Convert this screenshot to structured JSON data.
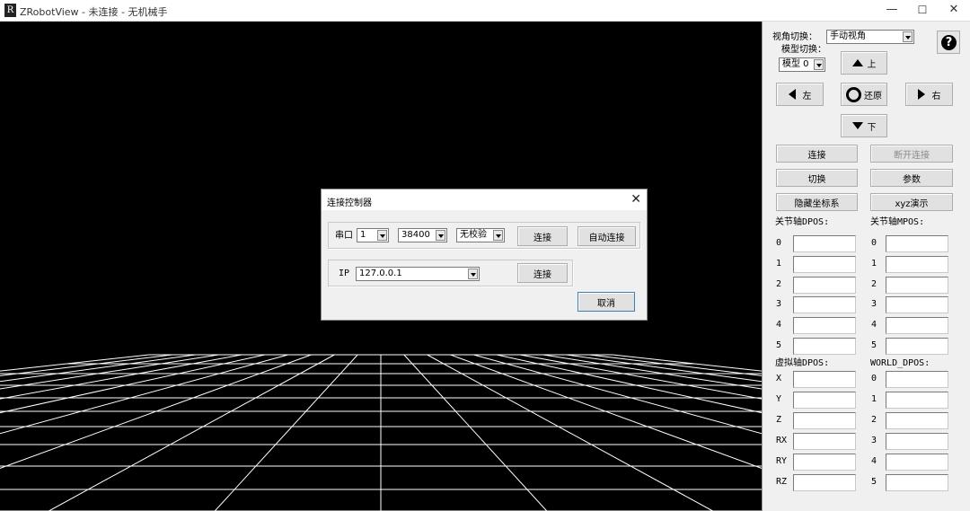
{
  "window": {
    "title": "ZRobotView - 未连接 - 无机械手",
    "icon_letter": "R",
    "minimize": "—",
    "maximize": "☐",
    "close": "✕"
  },
  "panel": {
    "view_switch_label": "视角切换：",
    "view_switch_value": "手动视角",
    "model_switch_label": "模型切换：",
    "model_value": "模型 0",
    "help": "?",
    "nav": {
      "up": "上",
      "left": "左",
      "reset": "还原",
      "right": "右",
      "down": "下"
    },
    "buttons": {
      "connect": "连接",
      "disconnect": "断开连接",
      "switch": "切换",
      "params": "参数",
      "hide_coords": "隐藏坐标系",
      "xyz_demo": "xyz演示"
    },
    "joint_dpos_title": "关节轴DPOS:",
    "joint_mpos_title": "关节轴MPOS:",
    "virtual_dpos_title": "虚拟轴DPOS:",
    "world_dpos_title": "WORLD_DPOS:",
    "joint_indices": [
      "0",
      "1",
      "2",
      "3",
      "4",
      "5"
    ],
    "virtual_axes": [
      "X",
      "Y",
      "Z",
      "RX",
      "RY",
      "RZ"
    ],
    "world_indices": [
      "0",
      "1",
      "2",
      "3",
      "4",
      "5"
    ]
  },
  "dialog": {
    "title": "连接控制器",
    "close": "✕",
    "serial_label": "串口",
    "port_value": "1",
    "baud_value": "38400",
    "parity_value": "无校验",
    "serial_connect": "连接",
    "auto_connect": "自动连接",
    "ip_label": "IP",
    "ip_value": "127.0.0.1",
    "ip_connect": "连接",
    "cancel": "取消"
  }
}
